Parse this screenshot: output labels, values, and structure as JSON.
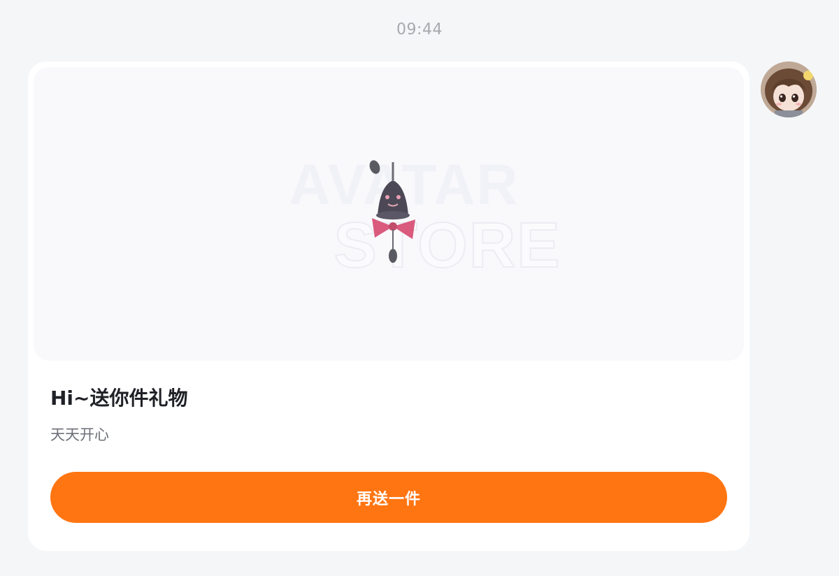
{
  "message": {
    "time": "09:44"
  },
  "sender": {
    "avatar_icon": "avatar-doll-girl"
  },
  "gift_card": {
    "preview_watermark_line1": "AVATAR",
    "preview_watermark_line2": "STORE",
    "preview_item_icon": "bell-charm-with-pink-bow",
    "title": "Hi~送你件礼物",
    "subtitle": "天天开心",
    "button_label": "再送一件",
    "button_color": "#ff7512"
  },
  "colors": {
    "background": "#f5f6f8",
    "card": "#ffffff",
    "accent": "#ff7512"
  }
}
